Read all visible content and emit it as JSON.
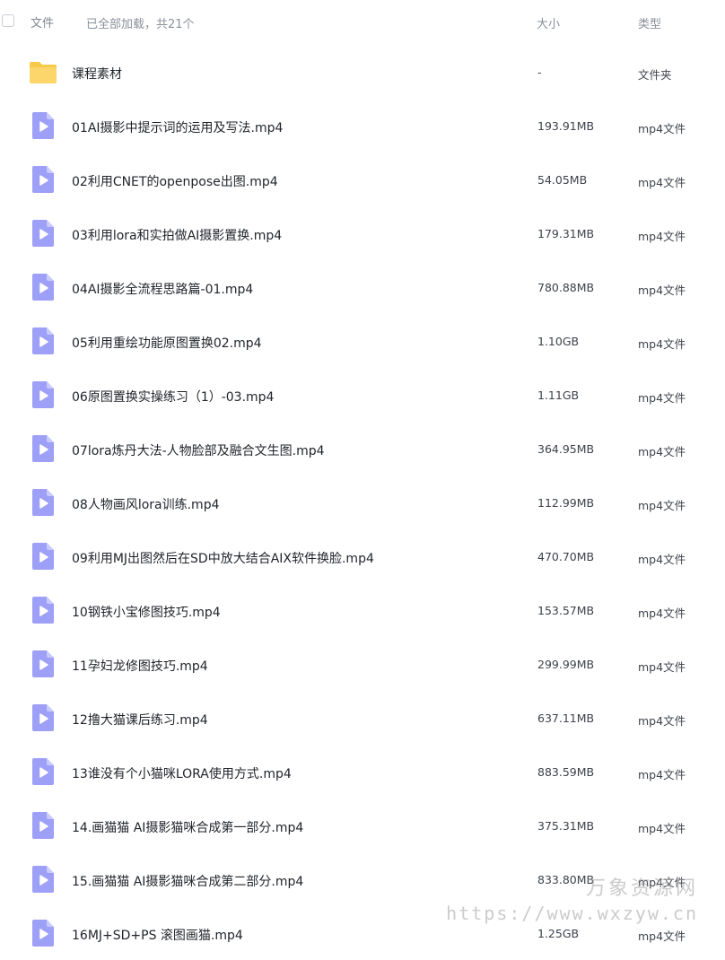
{
  "header": {
    "name_label": "文件",
    "status": "已全部加载，共21个",
    "size_label": "大小",
    "type_label": "类型"
  },
  "rows": [
    {
      "icon": "folder-icon",
      "name": "课程素材",
      "size": "-",
      "type": "文件夹"
    },
    {
      "icon": "video-file-icon",
      "name": "01AI摄影中提示词的运用及写法.mp4",
      "size": "193.91MB",
      "type": "mp4文件"
    },
    {
      "icon": "video-file-icon",
      "name": "02利用CNET的openpose出图.mp4",
      "size": "54.05MB",
      "type": "mp4文件"
    },
    {
      "icon": "video-file-icon",
      "name": "03利用lora和实拍做AI摄影置换.mp4",
      "size": "179.31MB",
      "type": "mp4文件"
    },
    {
      "icon": "video-file-icon",
      "name": "04AI摄影全流程思路篇-01.mp4",
      "size": "780.88MB",
      "type": "mp4文件"
    },
    {
      "icon": "video-file-icon",
      "name": "05利用重绘功能原图置换02.mp4",
      "size": "1.10GB",
      "type": "mp4文件"
    },
    {
      "icon": "video-file-icon",
      "name": "06原图置换实操练习（1）-03.mp4",
      "size": "1.11GB",
      "type": "mp4文件"
    },
    {
      "icon": "video-file-icon",
      "name": "07lora炼丹大法-人物脸部及融合文生图.mp4",
      "size": "364.95MB",
      "type": "mp4文件"
    },
    {
      "icon": "video-file-icon",
      "name": "08人物画风lora训练.mp4",
      "size": "112.99MB",
      "type": "mp4文件"
    },
    {
      "icon": "video-file-icon",
      "name": "09利用MJ出图然后在SD中放大结合AIX软件换脸.mp4",
      "size": "470.70MB",
      "type": "mp4文件"
    },
    {
      "icon": "video-file-icon",
      "name": "10钢铁小宝修图技巧.mp4",
      "size": "153.57MB",
      "type": "mp4文件"
    },
    {
      "icon": "video-file-icon",
      "name": "11孕妇龙修图技巧.mp4",
      "size": "299.99MB",
      "type": "mp4文件"
    },
    {
      "icon": "video-file-icon",
      "name": "12撸大猫课后练习.mp4",
      "size": "637.11MB",
      "type": "mp4文件"
    },
    {
      "icon": "video-file-icon",
      "name": "13谁没有个小猫咪LORA使用方式.mp4",
      "size": "883.59MB",
      "type": "mp4文件"
    },
    {
      "icon": "video-file-icon",
      "name": "14.画猫猫 AI摄影猫咪合成第一部分.mp4",
      "size": "375.31MB",
      "type": "mp4文件"
    },
    {
      "icon": "video-file-icon",
      "name": "15.画猫猫 AI摄影猫咪合成第二部分.mp4",
      "size": "833.80MB",
      "type": "mp4文件"
    },
    {
      "icon": "video-file-icon",
      "name": "16MJ+SD+PS 滚图画猫.mp4",
      "size": "1.25GB",
      "type": "mp4文件"
    }
  ],
  "watermark": {
    "line1": "万象资源网",
    "line2": "https://www.wxzyw.cn"
  },
  "colors": {
    "folder": "#fcd66b",
    "video_icon": "#9e9ff6",
    "text": "#1f2329",
    "muted": "#8a9099"
  }
}
